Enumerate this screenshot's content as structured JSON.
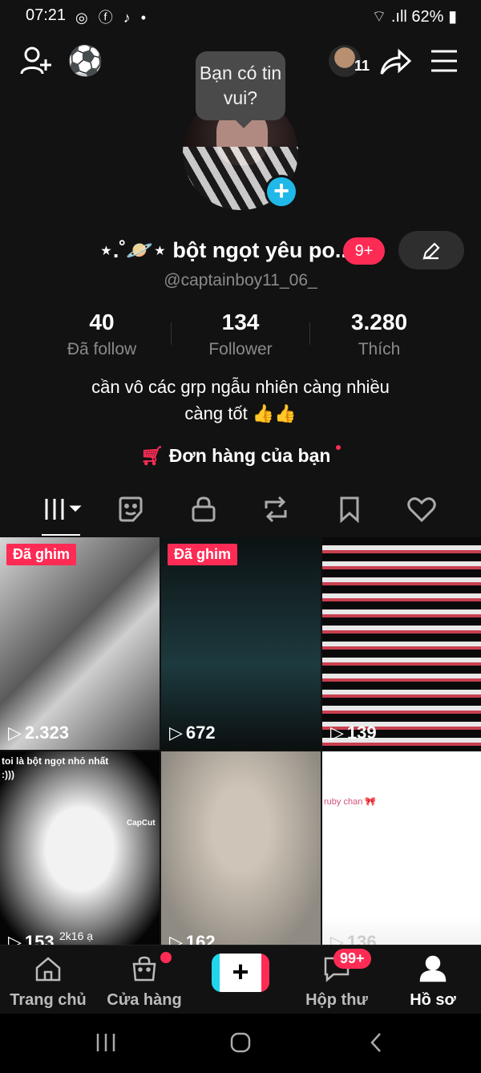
{
  "status_bar": {
    "time": "07:21",
    "app_icons": "◎ ⓕ ♪ •",
    "battery": "62%"
  },
  "header": {
    "notification_count": "11"
  },
  "bubble": {
    "text": "Bạn có tin vui?"
  },
  "profile": {
    "display_name": "⋆.˚🪐⋆ bột ngọt yêu po...",
    "name_badge": "9+",
    "username": "@captainboy11_06_",
    "stats": [
      {
        "value": "40",
        "label": "Đã follow"
      },
      {
        "value": "134",
        "label": "Follower"
      },
      {
        "value": "3.280",
        "label": "Thích"
      }
    ],
    "bio_line1": "cần vô các grp ngẫu nhiên càng nhiều",
    "bio_line2": "càng tốt 👍👍",
    "orders_label": "Đơn hàng của bạn"
  },
  "videos": [
    {
      "pinned": "Đã ghim",
      "views": "2.323"
    },
    {
      "pinned": "Đã ghim",
      "views": "672"
    },
    {
      "pinned": "",
      "views": "139"
    },
    {
      "caption": "toi là bột ngọt nhỏ nhất :)))",
      "overlay": "2k16 ạ",
      "watermark": "CapCut",
      "views": "153"
    },
    {
      "views": "162"
    },
    {
      "caption": "ruby chan 🎀",
      "views": "136"
    }
  ],
  "bottom_nav": {
    "home": "Trang chủ",
    "shop": "Cửa hàng",
    "inbox": "Hộp thư",
    "inbox_badge": "99+",
    "profile": "Hồ sơ"
  },
  "colors": {
    "accent": "#fe2c55",
    "cyan": "#20d5ec",
    "background": "#121212"
  }
}
